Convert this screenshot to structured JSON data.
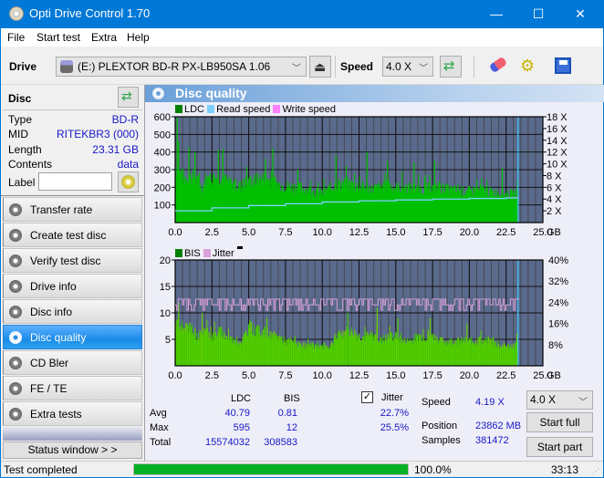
{
  "window": {
    "title": "Opti Drive Control 1.70",
    "controls": {
      "minimize": "—",
      "maximize": "☐",
      "close": "✕"
    }
  },
  "menu": [
    "File",
    "Start test",
    "Extra",
    "Help"
  ],
  "toolbar": {
    "drive_label": "Drive",
    "drive_value": "(E:)  PLEXTOR BD-R  PX-LB950SA 1.06",
    "speed_label": "Speed",
    "speed_value": "4.0 X",
    "icons": [
      "eject-icon",
      "refresh-icon",
      "eraser-icon",
      "settings-icon",
      "save-icon"
    ]
  },
  "disc": {
    "header": "Disc",
    "fields": [
      {
        "label": "Type",
        "value": "BD-R"
      },
      {
        "label": "MID",
        "value": "RITEKBR3 (000)"
      },
      {
        "label": "Length",
        "value": "23.31 GB"
      },
      {
        "label": "Contents",
        "value": "data"
      }
    ],
    "label_field_label": "Label",
    "label_field_value": ""
  },
  "nav": [
    {
      "label": "Transfer rate",
      "active": false
    },
    {
      "label": "Create test disc",
      "active": false
    },
    {
      "label": "Verify test disc",
      "active": false
    },
    {
      "label": "Drive info",
      "active": false
    },
    {
      "label": "Disc info",
      "active": false
    },
    {
      "label": "Disc quality",
      "active": true
    },
    {
      "label": "CD Bler",
      "active": false
    },
    {
      "label": "FE / TE",
      "active": false
    },
    {
      "label": "Extra tests",
      "active": false
    }
  ],
  "status_window_button": "Status window > >",
  "panel": {
    "title": "Disc quality"
  },
  "colors": {
    "plot_bg": "#5a6a8c",
    "ldc": "#00c000",
    "bis": "#44cc00",
    "read_speed": "#80d0ff",
    "write_speed": "#ff80ff",
    "jitter": "#d8a0d8",
    "accent": "#0078d7",
    "value_text": "#1818c8",
    "progress": "#06b025"
  },
  "chart_data": [
    {
      "type": "bar",
      "title": "LDC / Read speed",
      "legend": [
        "LDC",
        "Read speed",
        "Write speed"
      ],
      "legend_position": "top-left",
      "x_ticks": [
        "0.0",
        "2.5",
        "5.0",
        "7.5",
        "10.0",
        "12.5",
        "15.0",
        "17.5",
        "20.0",
        "22.5",
        "25.0"
      ],
      "x_unit": "GB",
      "xlim": [
        0,
        25
      ],
      "ylim": [
        0,
        600
      ],
      "y_ticks": [
        "100",
        "200",
        "300",
        "400",
        "500",
        "600"
      ],
      "y2_ticks": [
        "2 X",
        "4 X",
        "6 X",
        "8 X",
        "10 X",
        "12 X",
        "14 X",
        "16 X",
        "18 X"
      ],
      "y2lim": [
        0,
        18
      ],
      "grid": true,
      "end_marker_gb": 23.31,
      "ldc_profile": [
        [
          0.0,
          330
        ],
        [
          0.3,
          300
        ],
        [
          0.6,
          270
        ],
        [
          1.2,
          280
        ],
        [
          1.7,
          230
        ],
        [
          1.8,
          200
        ],
        [
          2.0,
          260
        ],
        [
          2.5,
          270
        ],
        [
          3.0,
          280
        ],
        [
          3.5,
          250
        ],
        [
          4.0,
          230
        ],
        [
          4.5,
          220
        ],
        [
          5.0,
          250
        ],
        [
          5.5,
          260
        ],
        [
          6.0,
          270
        ],
        [
          6.5,
          260
        ],
        [
          7.0,
          230
        ],
        [
          7.5,
          225
        ],
        [
          8.0,
          215
        ],
        [
          8.5,
          210
        ],
        [
          9.0,
          200
        ],
        [
          9.5,
          185
        ],
        [
          10.0,
          180
        ],
        [
          10.5,
          210
        ],
        [
          11.0,
          230
        ],
        [
          11.5,
          240
        ],
        [
          12.0,
          230
        ],
        [
          12.5,
          220
        ],
        [
          13.0,
          210
        ],
        [
          13.5,
          205
        ],
        [
          14.0,
          215
        ],
        [
          14.5,
          225
        ],
        [
          15.0,
          210
        ],
        [
          15.5,
          215
        ],
        [
          16.0,
          210
        ],
        [
          16.5,
          200
        ],
        [
          17.0,
          205
        ],
        [
          17.5,
          210
        ],
        [
          18.0,
          210
        ],
        [
          18.5,
          200
        ],
        [
          19.0,
          195
        ],
        [
          19.5,
          190
        ],
        [
          20.0,
          190
        ],
        [
          20.5,
          200
        ],
        [
          21.0,
          195
        ],
        [
          21.5,
          185
        ],
        [
          22.0,
          180
        ],
        [
          22.5,
          170
        ],
        [
          23.0,
          175
        ],
        [
          23.31,
          180
        ]
      ],
      "ldc_spikes": [
        [
          0.1,
          595
        ],
        [
          0.2,
          460
        ],
        [
          0.9,
          430
        ],
        [
          1.3,
          400
        ],
        [
          2.9,
          410
        ],
        [
          3.2,
          420
        ],
        [
          6.1,
          360
        ],
        [
          6.6,
          420
        ],
        [
          8.3,
          300
        ],
        [
          10.9,
          380
        ],
        [
          13.0,
          400
        ],
        [
          14.4,
          350
        ],
        [
          16.2,
          340
        ],
        [
          17.6,
          350
        ],
        [
          22.2,
          310
        ]
      ],
      "read_speed_x": [
        [
          0.0,
          2.0
        ],
        [
          2.5,
          2.5
        ],
        [
          5.0,
          2.9
        ],
        [
          7.5,
          3.2
        ],
        [
          10.0,
          3.5
        ],
        [
          12.5,
          3.7
        ],
        [
          15.0,
          3.85
        ],
        [
          17.5,
          4.0
        ],
        [
          20.0,
          4.1
        ],
        [
          22.5,
          4.2
        ],
        [
          23.31,
          4.25
        ]
      ]
    },
    {
      "type": "bar",
      "title": "BIS / Jitter",
      "legend": [
        "BIS",
        "Jitter"
      ],
      "legend_position": "top-left",
      "x_ticks": [
        "0.0",
        "2.5",
        "5.0",
        "7.5",
        "10.0",
        "12.5",
        "15.0",
        "17.5",
        "20.0",
        "22.5",
        "25.0"
      ],
      "x_unit": "GB",
      "xlim": [
        0,
        25
      ],
      "ylim": [
        0,
        20
      ],
      "y_ticks": [
        "5",
        "10",
        "15",
        "20"
      ],
      "y2_ticks": [
        "8%",
        "16%",
        "24%",
        "32%",
        "40%"
      ],
      "y2lim": [
        0,
        40
      ],
      "grid": true,
      "end_marker_gb": 23.31,
      "bis_profile": [
        [
          0.0,
          9
        ],
        [
          0.5,
          7
        ],
        [
          1.0,
          8
        ],
        [
          1.5,
          6
        ],
        [
          2.0,
          7
        ],
        [
          2.5,
          6
        ],
        [
          3.0,
          7
        ],
        [
          3.5,
          6
        ],
        [
          4.0,
          5
        ],
        [
          4.5,
          5
        ],
        [
          5.0,
          8
        ],
        [
          5.5,
          7
        ],
        [
          6.0,
          7
        ],
        [
          6.5,
          6
        ],
        [
          7.0,
          6
        ],
        [
          7.5,
          5
        ],
        [
          8.0,
          5
        ],
        [
          8.5,
          4
        ],
        [
          9.0,
          4
        ],
        [
          9.5,
          4
        ],
        [
          10.0,
          4
        ],
        [
          10.5,
          4
        ],
        [
          11.0,
          6
        ],
        [
          11.5,
          7
        ],
        [
          12.0,
          7
        ],
        [
          12.5,
          6
        ],
        [
          13.0,
          6
        ],
        [
          13.5,
          6
        ],
        [
          14.0,
          5
        ],
        [
          14.5,
          6
        ],
        [
          15.0,
          6
        ],
        [
          15.5,
          5
        ],
        [
          16.0,
          5
        ],
        [
          16.5,
          6
        ],
        [
          17.0,
          6
        ],
        [
          17.5,
          6
        ],
        [
          18.0,
          5
        ],
        [
          18.5,
          5
        ],
        [
          19.0,
          5
        ],
        [
          19.5,
          5
        ],
        [
          20.0,
          5
        ],
        [
          20.5,
          5
        ],
        [
          21.0,
          5
        ],
        [
          21.5,
          5
        ],
        [
          22.0,
          4
        ],
        [
          22.5,
          4
        ],
        [
          23.0,
          4
        ],
        [
          23.31,
          5
        ]
      ],
      "bis_max": 12,
      "jitter_percent_range": [
        20.5,
        25.5
      ],
      "jitter_avg_percent": 22.7
    }
  ],
  "stats": {
    "col_headers": [
      "LDC",
      "BIS"
    ],
    "rows": [
      {
        "label": "Avg",
        "ldc": "40.79",
        "bis": "0.81",
        "jitter": "22.7%"
      },
      {
        "label": "Max",
        "ldc": "595",
        "bis": "12",
        "jitter": "25.5%"
      },
      {
        "label": "Total",
        "ldc": "15574032",
        "bis": "308583",
        "jitter": ""
      }
    ],
    "jitter_label": "Jitter",
    "jitter_checked": true,
    "speed_label": "Speed",
    "speed_value": "4.19 X",
    "position_label": "Position",
    "position_value": "23862 MB",
    "samples_label": "Samples",
    "samples_value": "381472",
    "speed_select": "4.0 X",
    "start_full": "Start full",
    "start_part": "Start part"
  },
  "statusbar": {
    "text": "Test completed",
    "progress_percent": 100.0,
    "progress_label": "100.0%",
    "elapsed": "33:13"
  }
}
